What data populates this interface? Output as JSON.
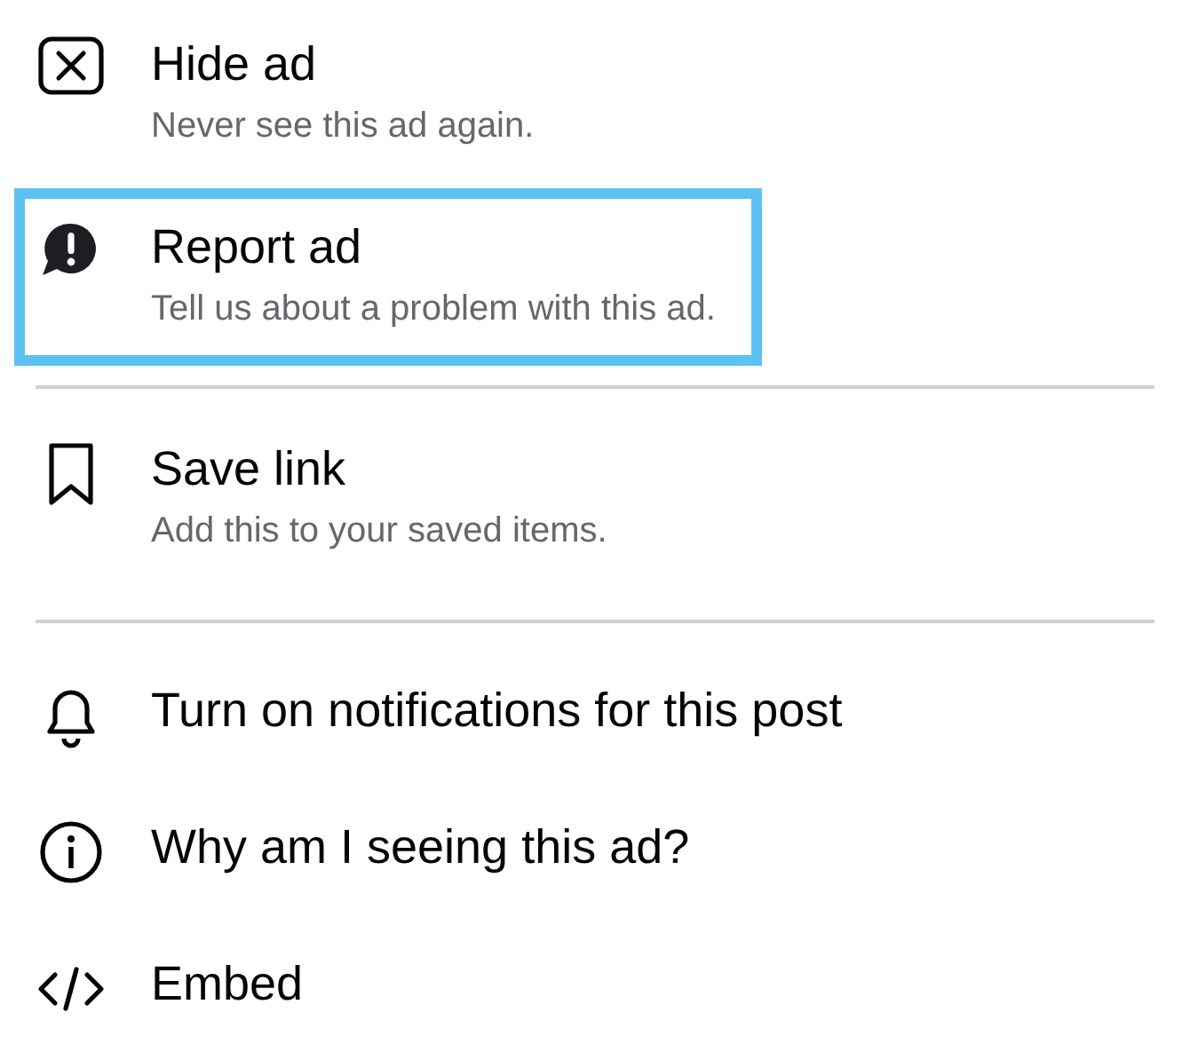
{
  "menu": {
    "sections": [
      {
        "items": [
          {
            "title": "Hide ad",
            "subtitle": "Never see this ad again.",
            "highlighted": false
          },
          {
            "title": "Report ad",
            "subtitle": "Tell us about a problem with this ad.",
            "highlighted": true
          }
        ]
      },
      {
        "items": [
          {
            "title": "Save link",
            "subtitle": "Add this to your saved items.",
            "highlighted": false
          }
        ]
      },
      {
        "items": [
          {
            "title": "Turn on notifications for this post",
            "highlighted": false
          },
          {
            "title": "Why am I seeing this ad?",
            "highlighted": false
          },
          {
            "title": "Embed",
            "highlighted": false
          }
        ]
      }
    ]
  }
}
